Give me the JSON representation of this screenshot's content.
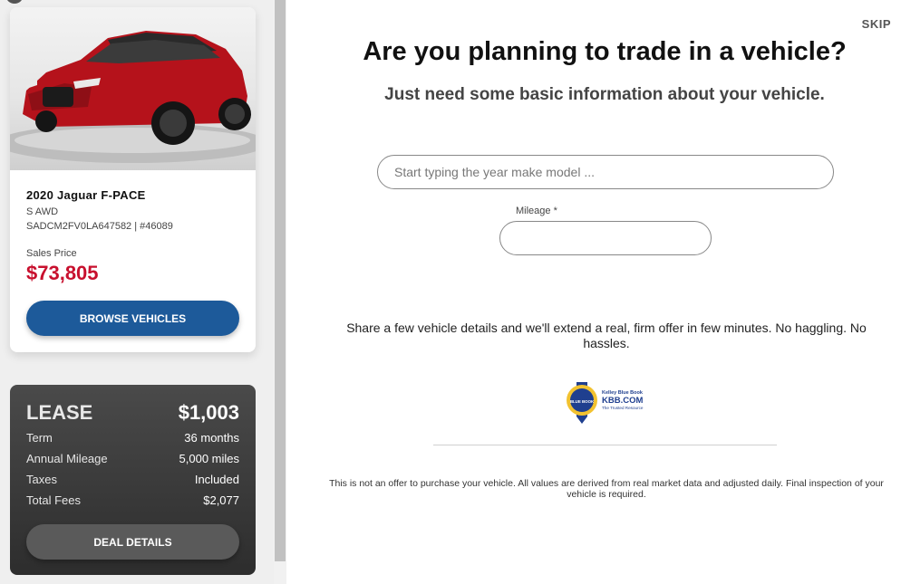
{
  "vehicle": {
    "title": "2020 Jaguar F-PACE",
    "trim": "S AWD",
    "vin_stock": "SADCM2FV0LA647582 | #46089",
    "price_label": "Sales Price",
    "price": "$73,805",
    "browse_label": "BROWSE VEHICLES"
  },
  "lease": {
    "label": "LEASE",
    "amount": "$1,003",
    "rows": [
      {
        "label": "Term",
        "value": "36 months"
      },
      {
        "label": "Annual Mileage",
        "value": "5,000 miles"
      },
      {
        "label": "Taxes",
        "value": "Included"
      },
      {
        "label": "Total Fees",
        "value": "$2,077"
      }
    ],
    "details_label": "DEAL DETAILS"
  },
  "trade_in": {
    "skip_label": "SKIP",
    "title": "Are you planning to trade in a vehicle?",
    "subtitle": "Just need some basic information about your vehicle.",
    "ymm_placeholder": "Start typing the year make model ...",
    "mileage_label": "Mileage *",
    "mileage_value": "",
    "share_text": "Share a few vehicle details and we'll extend a real, firm offer in few minutes. No haggling. No hassles.",
    "kbb": {
      "brand": "Kelley Blue Book",
      "site": "KBB.COM",
      "tagline": "The Trusted Resource",
      "badge": "BLUE BOOK"
    },
    "disclaimer": "This is not an offer to purchase your vehicle. All values are derived from real market data and adjusted daily. Final inspection of your vehicle is required."
  },
  "colors": {
    "price_red": "#c8102e",
    "button_blue": "#1d5a9a",
    "lease_dark": "#3a3a3a",
    "car_red": "#b5121b"
  },
  "icons": {
    "logo": "kbb-logo"
  }
}
